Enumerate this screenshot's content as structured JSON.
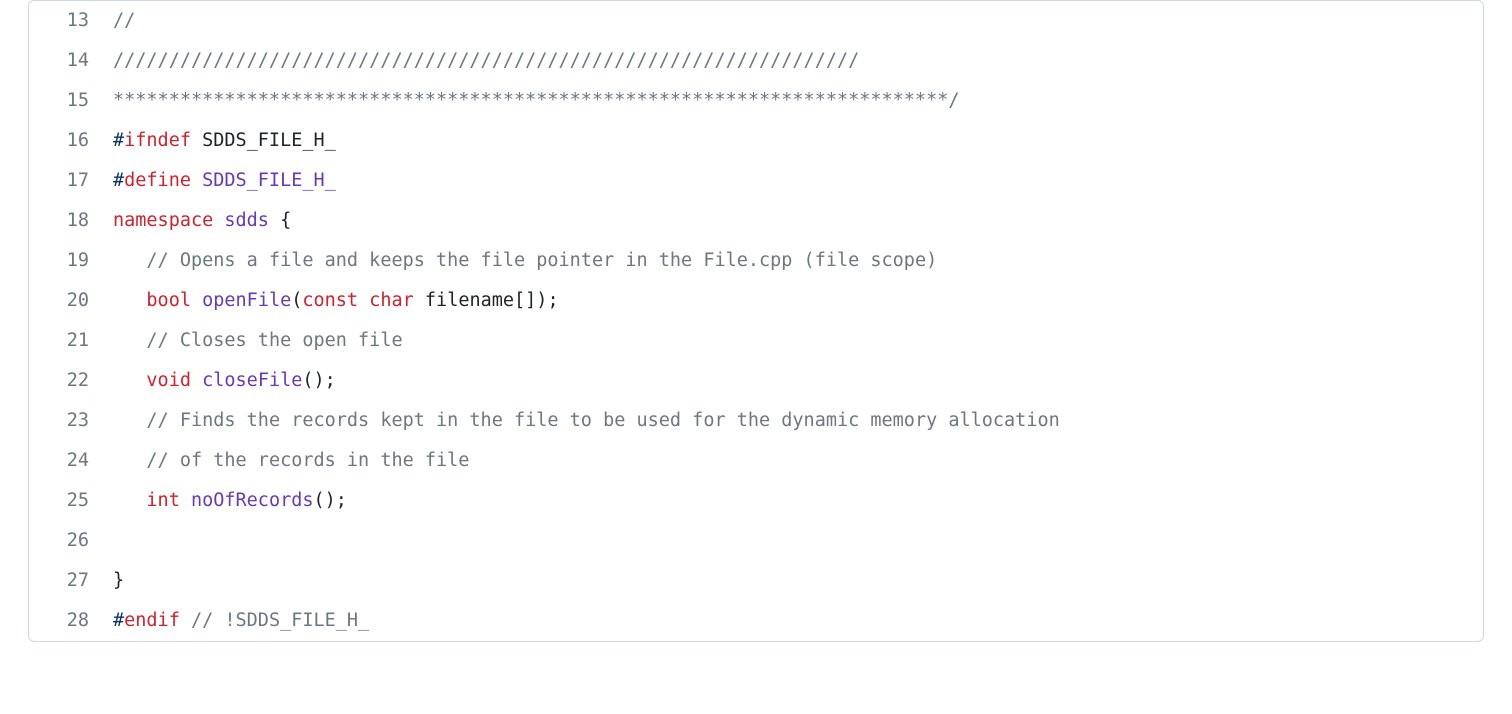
{
  "code": {
    "lines": [
      {
        "num": "13",
        "tokens": [
          {
            "cls": "pl-c",
            "text": "//"
          }
        ]
      },
      {
        "num": "14",
        "tokens": [
          {
            "cls": "pl-c",
            "text": "///////////////////////////////////////////////////////////////////"
          }
        ]
      },
      {
        "num": "15",
        "tokens": [
          {
            "cls": "pl-c",
            "text": "***************************************************************************/"
          }
        ]
      },
      {
        "num": "16",
        "tokens": [
          {
            "cls": "pl-s",
            "text": "#"
          },
          {
            "cls": "pl-k",
            "text": "ifndef"
          },
          {
            "cls": "",
            "text": " "
          },
          {
            "cls": "pl-smi",
            "text": "SDDS_FILE_H_"
          }
        ]
      },
      {
        "num": "17",
        "tokens": [
          {
            "cls": "pl-s",
            "text": "#"
          },
          {
            "cls": "pl-k",
            "text": "define"
          },
          {
            "cls": "",
            "text": " "
          },
          {
            "cls": "pl-en",
            "text": "SDDS_FILE_H_"
          }
        ]
      },
      {
        "num": "18",
        "tokens": [
          {
            "cls": "pl-k",
            "text": "namespace"
          },
          {
            "cls": "",
            "text": " "
          },
          {
            "cls": "pl-en",
            "text": "sdds"
          },
          {
            "cls": "",
            "text": " {"
          }
        ]
      },
      {
        "num": "19",
        "tokens": [
          {
            "cls": "",
            "text": "   "
          },
          {
            "cls": "pl-c",
            "text": "// Opens a file and keeps the file pointer in the File.cpp (file scope)"
          }
        ]
      },
      {
        "num": "20",
        "tokens": [
          {
            "cls": "",
            "text": "   "
          },
          {
            "cls": "pl-k",
            "text": "bool"
          },
          {
            "cls": "",
            "text": " "
          },
          {
            "cls": "pl-en",
            "text": "openFile"
          },
          {
            "cls": "",
            "text": "("
          },
          {
            "cls": "pl-k",
            "text": "const"
          },
          {
            "cls": "",
            "text": " "
          },
          {
            "cls": "pl-k",
            "text": "char"
          },
          {
            "cls": "",
            "text": " "
          },
          {
            "cls": "pl-smi",
            "text": "filename"
          },
          {
            "cls": "",
            "text": "[]);"
          }
        ]
      },
      {
        "num": "21",
        "tokens": [
          {
            "cls": "",
            "text": "   "
          },
          {
            "cls": "pl-c",
            "text": "// Closes the open file"
          }
        ]
      },
      {
        "num": "22",
        "tokens": [
          {
            "cls": "",
            "text": "   "
          },
          {
            "cls": "pl-k",
            "text": "void"
          },
          {
            "cls": "",
            "text": " "
          },
          {
            "cls": "pl-en",
            "text": "closeFile"
          },
          {
            "cls": "",
            "text": "();"
          }
        ]
      },
      {
        "num": "23",
        "tokens": [
          {
            "cls": "",
            "text": "   "
          },
          {
            "cls": "pl-c",
            "text": "// Finds the records kept in the file to be used for the dynamic memory allocation"
          }
        ]
      },
      {
        "num": "24",
        "tokens": [
          {
            "cls": "",
            "text": "   "
          },
          {
            "cls": "pl-c",
            "text": "// of the records in the file"
          }
        ]
      },
      {
        "num": "25",
        "tokens": [
          {
            "cls": "",
            "text": "   "
          },
          {
            "cls": "pl-k",
            "text": "int"
          },
          {
            "cls": "",
            "text": " "
          },
          {
            "cls": "pl-en",
            "text": "noOfRecords"
          },
          {
            "cls": "",
            "text": "();"
          }
        ]
      },
      {
        "num": "26",
        "tokens": [
          {
            "cls": "",
            "text": ""
          }
        ]
      },
      {
        "num": "27",
        "tokens": [
          {
            "cls": "",
            "text": "}"
          }
        ]
      },
      {
        "num": "28",
        "tokens": [
          {
            "cls": "pl-s",
            "text": "#"
          },
          {
            "cls": "pl-k",
            "text": "endif"
          },
          {
            "cls": "",
            "text": " "
          },
          {
            "cls": "pl-c",
            "text": "// !SDDS_FILE_H_"
          }
        ]
      }
    ]
  }
}
